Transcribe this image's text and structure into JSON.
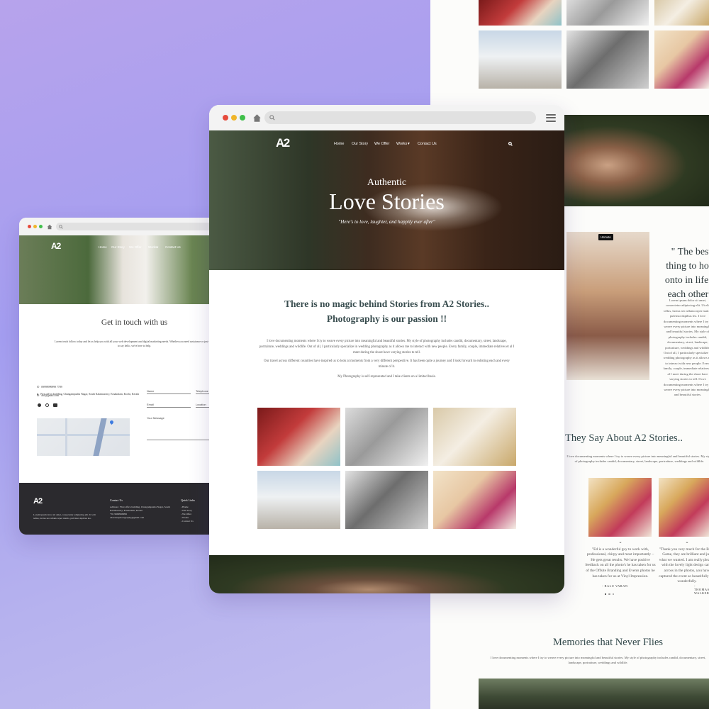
{
  "brand": {
    "logo": "A2"
  },
  "nav": {
    "items": [
      "Home",
      "Our Story",
      "We Offer",
      "Works",
      "Contact Us"
    ]
  },
  "hero": {
    "subtitle": "Authentic",
    "title": "Love Stories",
    "tagline": "\"Here's to love, laughter, and happily ever after\""
  },
  "intro": {
    "heading_line1": "There is no magic behind Stories from A2 Stories..",
    "heading_line2": "Photography is our passion !!",
    "paragraph1": "I love documenting moments where I try to weave every picture into meaningful and beautiful stories. My style of photography includes candid, documentary, street, landscape, portraiture, weddings and wildlife. Out of all, I particularly specialize in wedding photography as it allows me to interact with new people. Every family, couple, immediate relatives et al I meet during the shoot have varying stories to tell.",
    "paragraph2": "Our travel across different countries have inspired us to look at moments from a very different perspective. It has been quite a journey and I look forward to enlisting each and every minute of it.",
    "paragraph3": "My Photography is self-represented and I take clients on a limited basis."
  },
  "right_page": {
    "unmute_label": "Unmute",
    "quote": "\" The best thing to hold onto in life is each other \"",
    "about_text": "Lorem ipsum dolor sit amet, consectetur adipiscing elit. Ut elit tellus, luctus nec ullamcorper mattis, pulvinar dapibus leo. I love documenting moments where I try to weave every picture into meaningful and beautiful stories. My style of photography includes candid, documentary, street, landscape, portraiture, weddings and wildlife. Out of all, I particularly specialize in wedding photography as it allows me to interact with new people. Every family, couple, immediate relatives et al I meet during the shoot have varying stories to tell. I love documenting moments where I try to weave every picture into meaningful and beautiful stories.",
    "testimonials_heading": "They Say About A2 Stories..",
    "testimonials_sub": "I love documenting moments where I try to weave every picture into meaningful and beautiful stories. My style of photography includes candid, documentary, street, landscape, portraiture, weddings and wildlife.",
    "testimonials": [
      {
        "text": "\"Ed is a wonderful guy to work with, professional, chirpy and most importantly – He gets great results. We have positive feedback on all the photo's he has taken for us of the Offsite Branding and Events photos he has taken for us at Vinyl Impression.",
        "name": "- BALU VARAN"
      },
      {
        "text": "\"Thank you very much for the Brain Game, they are brilliant and just what we wanted. I am really pleased with the lovely light design came across in the photos, you have captured the event so beautifully and wonderfully.",
        "name": "- THOMAS WALKER"
      }
    ],
    "memories_heading": "Memories that Never Flies",
    "memories_text": "I love documenting moments where I try to weave every picture into meaningful and beautiful stories. My style of photography includes candid, documentary, street, landscape, portraiture, weddings and wildlife."
  },
  "contact_page": {
    "heading": "Get in touch with us",
    "intro": "Lorem teach follow today and let us help you with all your web development and digital marketing needs. Whether you need assistance or just want to say hello, we're here to help.",
    "address": "First office building, Changampuzha Nagar, South Kalamassery, Ernakulam, Kochi, Kerala",
    "phone": "09999999999 7789",
    "email": "abc@gmail.com",
    "form": {
      "name": "Name",
      "telephone": "Telephone",
      "email": "Email",
      "location": "Location",
      "message": "Your Message"
    },
    "footer": {
      "about": "Lorem ipsum dolor sit amet, consectetur adipiscing elit. Ut elit tellus, luctus nec ullamcorper mattis, pulvinar dapibus leo.",
      "contact_heading": "Contact Us",
      "contact_address": "Address : First office building, Changampuzha Nagar, South Kalamassery, Ernakulam, Kerala",
      "contact_phone": "+91 9999999999",
      "contact_email": "a2storiesphotography@gmail.com",
      "links_heading": "Quick Links",
      "links": [
        "Home",
        "Our Story",
        "We Offer",
        "Works",
        "Contact Us"
      ]
    }
  },
  "colors": {
    "background_gradient": [
      "#b7a3ec",
      "#c7c3f0"
    ],
    "heading_teal": "#3a4e50",
    "footer_dark": "#2b2a2e",
    "traffic_red": "#e64a3c",
    "traffic_yellow": "#f0b52a",
    "traffic_green": "#3fbf4a"
  }
}
